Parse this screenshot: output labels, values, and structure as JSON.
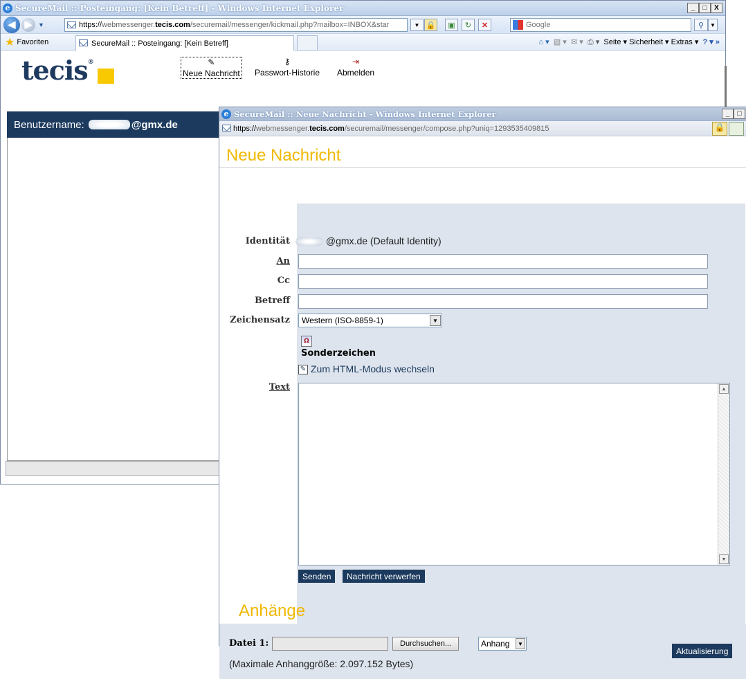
{
  "back_window": {
    "title": "SecureMail :: Posteingang: [Kein Betreff] - Windows Internet Explorer",
    "controls": [
      "_",
      "□",
      "X"
    ],
    "address_prefix": "https://",
    "address_domain_pre": "webmessenger.",
    "address_domain": "tecis.com",
    "address_path": "/securemail/messenger/kickmail.php?mailbox=INBOX&star",
    "search_placeholder": "Google",
    "favorites_label": "Favoriten",
    "tab_label": "SecureMail :: Posteingang: [Kein Betreff]",
    "command_bar": "Seite ▾   Sicherheit ▾   Extras ▾",
    "logo_text": "tecis",
    "logo_reg": "®",
    "toolbar": {
      "new_message": "Neue Nachricht",
      "password_history": "Passwort-Historie",
      "logout": "Abmelden"
    },
    "username_label": "Benutzername:",
    "username_suffix": "@gmx.de"
  },
  "compose_window": {
    "title": "SecureMail :: Neue Nachricht - Windows Internet Explorer",
    "address_prefix": "https://",
    "address_domain_pre": "webmessenger.",
    "address_domain": "tecis.com",
    "address_path": "/securemail/messenger/compose.php?uniq=1293535409815",
    "heading": "Neue Nachricht",
    "send_label": "Senden",
    "discard_label": "Nachricht verwerfen",
    "labels": {
      "identity": "Identität",
      "to": "An",
      "cc": "Cc",
      "subject": "Betreff",
      "charset": "Zeichensatz",
      "text": "Text"
    },
    "identity_value": "@gmx.de (Default Identity)",
    "to_value": "",
    "cc_value": "",
    "subject_value": "",
    "charset_selected": "Western (ISO-8859-1)",
    "special_chars": "Sonderzeichen",
    "html_mode": "Zum HTML-Modus wechseln",
    "attachments_heading": "Anhänge",
    "file_label": "Datei 1:",
    "browse_label": "Durchsuchen...",
    "attach_select": "Anhang",
    "update_label": "Aktualisierung",
    "max_size": "(Maximale Anhanggröße: 2.097.152 Bytes)"
  },
  "colors": {
    "accent_yellow": "#f0b800",
    "navy": "#1c3a5e",
    "panel": "#dde4ed"
  }
}
